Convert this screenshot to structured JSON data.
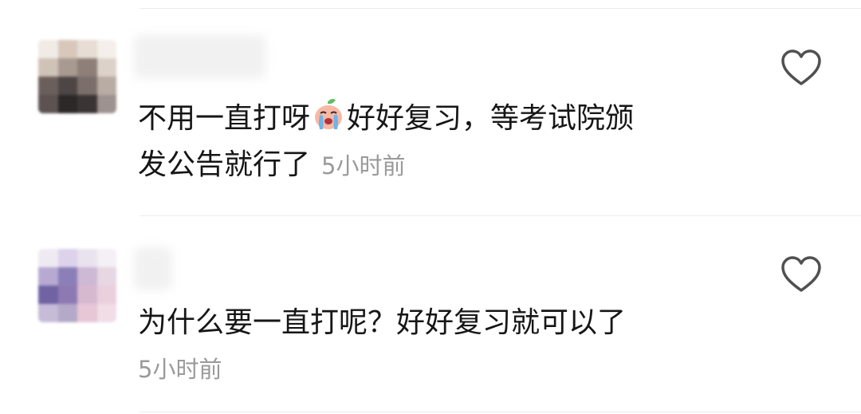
{
  "comments": [
    {
      "line1_a": "不用一直打呀",
      "line1_b": "好好复习，等考试院颁",
      "line2": "发公告就行了",
      "time": "5小时前",
      "emoji_icon": "crying-peach-sticker",
      "avatar_colors": [
        "#f1ebe6",
        "#d8c8bc",
        "#e7ddd4",
        "#f4efea",
        "#cfc3b8",
        "#a99a91",
        "#8e7f78",
        "#dcd2ca",
        "#6a5f5b",
        "#4e4645",
        "#7c6f6b",
        "#b9aca4",
        "#5c5252",
        "#2c2828",
        "#3b3434",
        "#9e9290"
      ]
    },
    {
      "line1": "为什么要一直打呢？好好复习就可以了",
      "time": "5小时前",
      "avatar_colors": [
        "#efeaf2",
        "#dcd2ea",
        "#e9e3ee",
        "#f4f0f5",
        "#b7a9d1",
        "#8c7fb8",
        "#cdb8d5",
        "#e6d7e3",
        "#6f63a3",
        "#8e7ab2",
        "#d7b9cf",
        "#ead0dd",
        "#c6bcd8",
        "#b4a9c7",
        "#e7c6d6",
        "#f1dde6"
      ]
    }
  ],
  "like_icon": "heart-outline-icon"
}
